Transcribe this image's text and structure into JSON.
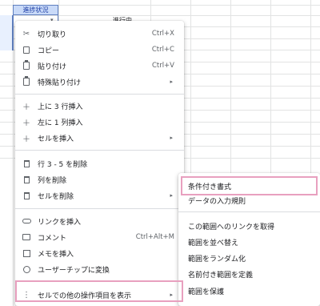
{
  "sheet": {
    "header_cell": "進捗状況",
    "dropdown_arrow": "▾",
    "cell_value": "進行中"
  },
  "context_menu": {
    "items": [
      {
        "label": "切り取り",
        "shortcut": "Ctrl+X",
        "icon": "scissors-icon"
      },
      {
        "label": "コピー",
        "shortcut": "Ctrl+C",
        "icon": "copy-icon"
      },
      {
        "label": "貼り付け",
        "shortcut": "Ctrl+V",
        "icon": "paste-icon"
      },
      {
        "label": "特殊貼り付け",
        "submenu_arrow": "▸",
        "icon": "paste-special-icon"
      },
      {
        "label": "上に 3 行挿入",
        "icon": "plus-icon"
      },
      {
        "label": "左に 1 列挿入",
        "icon": "plus-icon"
      },
      {
        "label": "セルを挿入",
        "submenu_arrow": "▸",
        "icon": "plus-icon"
      },
      {
        "label": "行 3 - 5 を削除",
        "icon": "trash-icon"
      },
      {
        "label": "列を削除",
        "icon": "trash-icon"
      },
      {
        "label": "セルを削除",
        "submenu_arrow": "▸",
        "icon": "trash-icon"
      },
      {
        "label": "リンクを挿入",
        "icon": "link-icon"
      },
      {
        "label": "コメント",
        "shortcut": "Ctrl+Alt+M",
        "icon": "comment-icon"
      },
      {
        "label": "メモを挿入",
        "icon": "note-icon"
      },
      {
        "label": "ユーザーチップに変換",
        "icon": "people-chip-icon"
      },
      {
        "label": "セルでの他の操作項目を表示",
        "submenu_arrow": "▸",
        "icon": "more-vertical-icon"
      }
    ]
  },
  "submenu": {
    "items": [
      {
        "label": "条件付き書式"
      },
      {
        "label": "データの入力規則"
      },
      {
        "label": "この範囲へのリンクを取得"
      },
      {
        "label": "範囲を並べ替え"
      },
      {
        "label": "範囲をランダム化"
      },
      {
        "label": "名前付き範囲を定義"
      },
      {
        "label": "範囲を保護"
      }
    ]
  },
  "highlight_color": "#e8a0bf",
  "selection_color": "#c9daf8"
}
